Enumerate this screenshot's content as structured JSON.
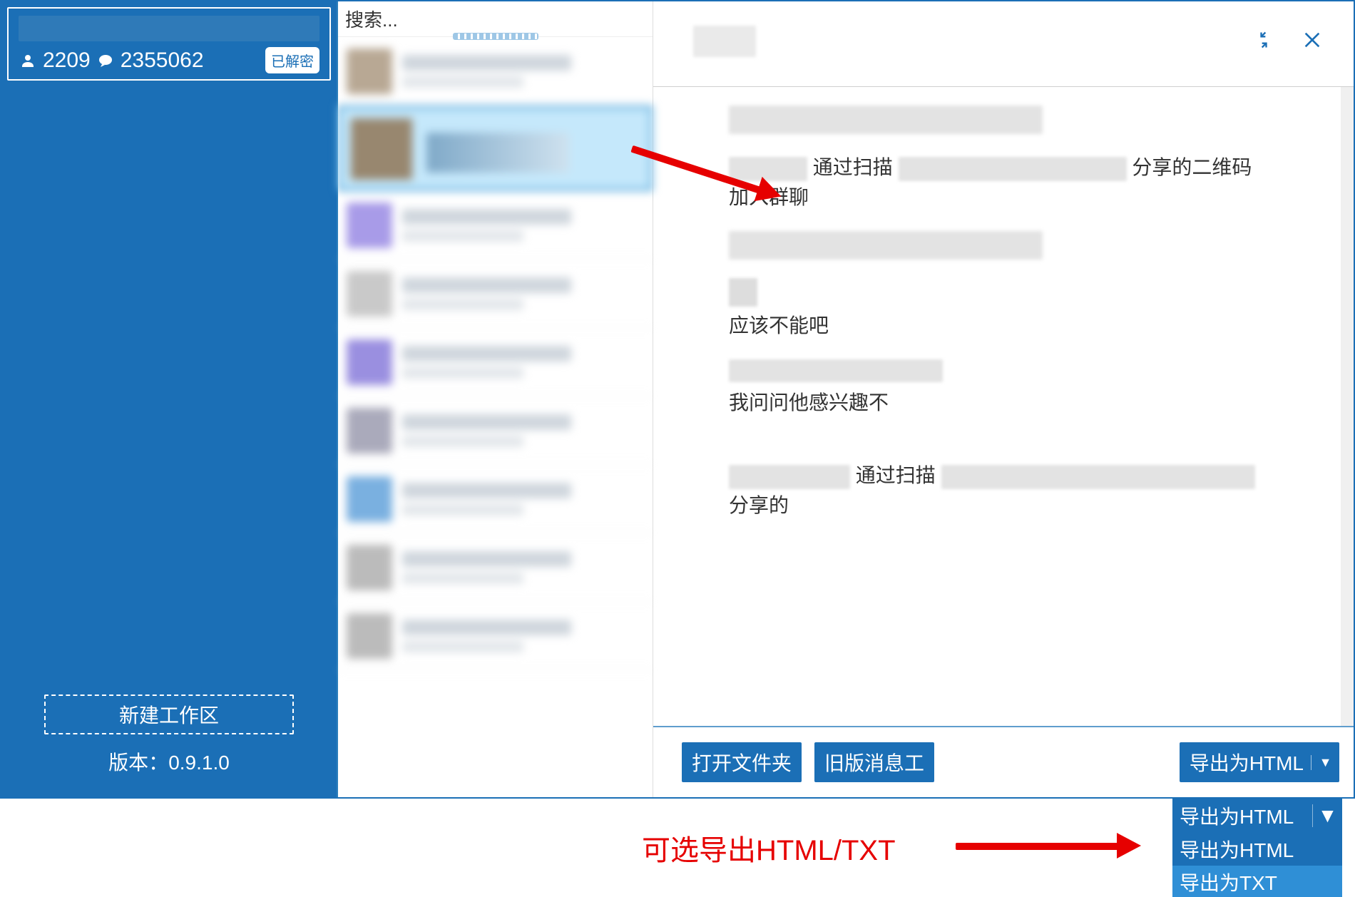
{
  "sidebar": {
    "contact_count": "2209",
    "message_count": "2355062",
    "decrypt_badge": "已解密",
    "new_workspace": "新建工作区",
    "version_label": "版本：",
    "version_value": "0.9.1.0"
  },
  "chatlist": {
    "search_placeholder": "搜索..."
  },
  "conversation": {
    "messages": [
      {
        "type": "blurred_line"
      },
      {
        "type": "system_join",
        "parts": [
          "通过扫描",
          "分享的二维码加入群聊"
        ]
      },
      {
        "type": "blurred_line"
      },
      {
        "type": "text",
        "text": "应该不能吧"
      },
      {
        "type": "text_blur_prefix",
        "text": "我问问他感兴趣不"
      },
      {
        "type": "system_join_cut",
        "parts": [
          "通过扫描",
          "分享的"
        ]
      }
    ],
    "footer": {
      "open_folder": "打开文件夹",
      "legacy_tool": "旧版消息工",
      "export_split_label": "导出为HTML"
    }
  },
  "annotation": {
    "text": "可选导出HTML/TXT",
    "dropdown": {
      "head": "导出为HTML",
      "items": [
        "导出为HTML",
        "导出为TXT"
      ]
    }
  }
}
